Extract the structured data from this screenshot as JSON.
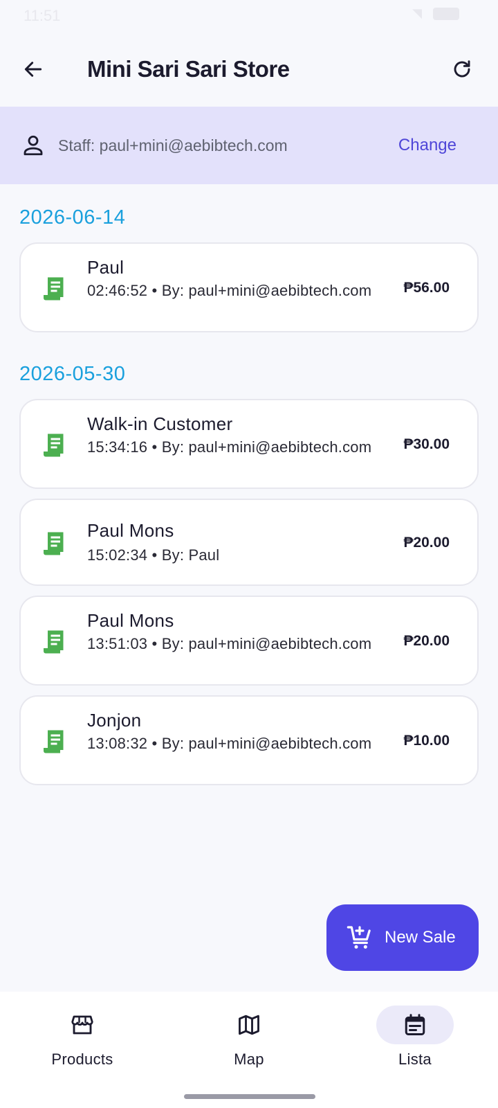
{
  "status_bar": {
    "time": "11:51"
  },
  "header": {
    "title": "Mini Sari Sari Store"
  },
  "staff_bar": {
    "label": "Staff: paul+mini@aebibtech.com",
    "change_label": "Change"
  },
  "groups": [
    {
      "date": "2026-06-14",
      "sales": [
        {
          "customer": "Paul",
          "meta": "02:46:52 • By: paul+mini@aebibtech.com",
          "amount": "₱56.00"
        }
      ]
    },
    {
      "date": "2026-05-30",
      "sales": [
        {
          "customer": "Walk-in Customer",
          "meta": "15:34:16 • By: paul+mini@aebibtech.com",
          "amount": "₱30.00"
        },
        {
          "customer": "Paul Mons",
          "meta": "15:02:34 • By: Paul",
          "amount": "₱20.00"
        },
        {
          "customer": "Paul Mons",
          "meta": "13:51:03 • By: paul+mini@aebibtech.com",
          "amount": "₱20.00"
        },
        {
          "customer": "Jonjon",
          "meta": "13:08:32 • By: paul+mini@aebibtech.com",
          "amount": "₱10.00"
        }
      ]
    }
  ],
  "fab": {
    "label": "New Sale"
  },
  "bottom_nav": {
    "items": [
      {
        "label": "Products",
        "icon": "store-icon",
        "active": false
      },
      {
        "label": "Map",
        "icon": "map-icon",
        "active": false
      },
      {
        "label": "Lista",
        "icon": "list-calendar-icon",
        "active": true
      }
    ]
  },
  "colors": {
    "accent": "#4f46e5",
    "date_heading": "#1aa0dd",
    "receipt_icon": "#4caf50",
    "staff_bar_bg": "#e3e1fb"
  }
}
